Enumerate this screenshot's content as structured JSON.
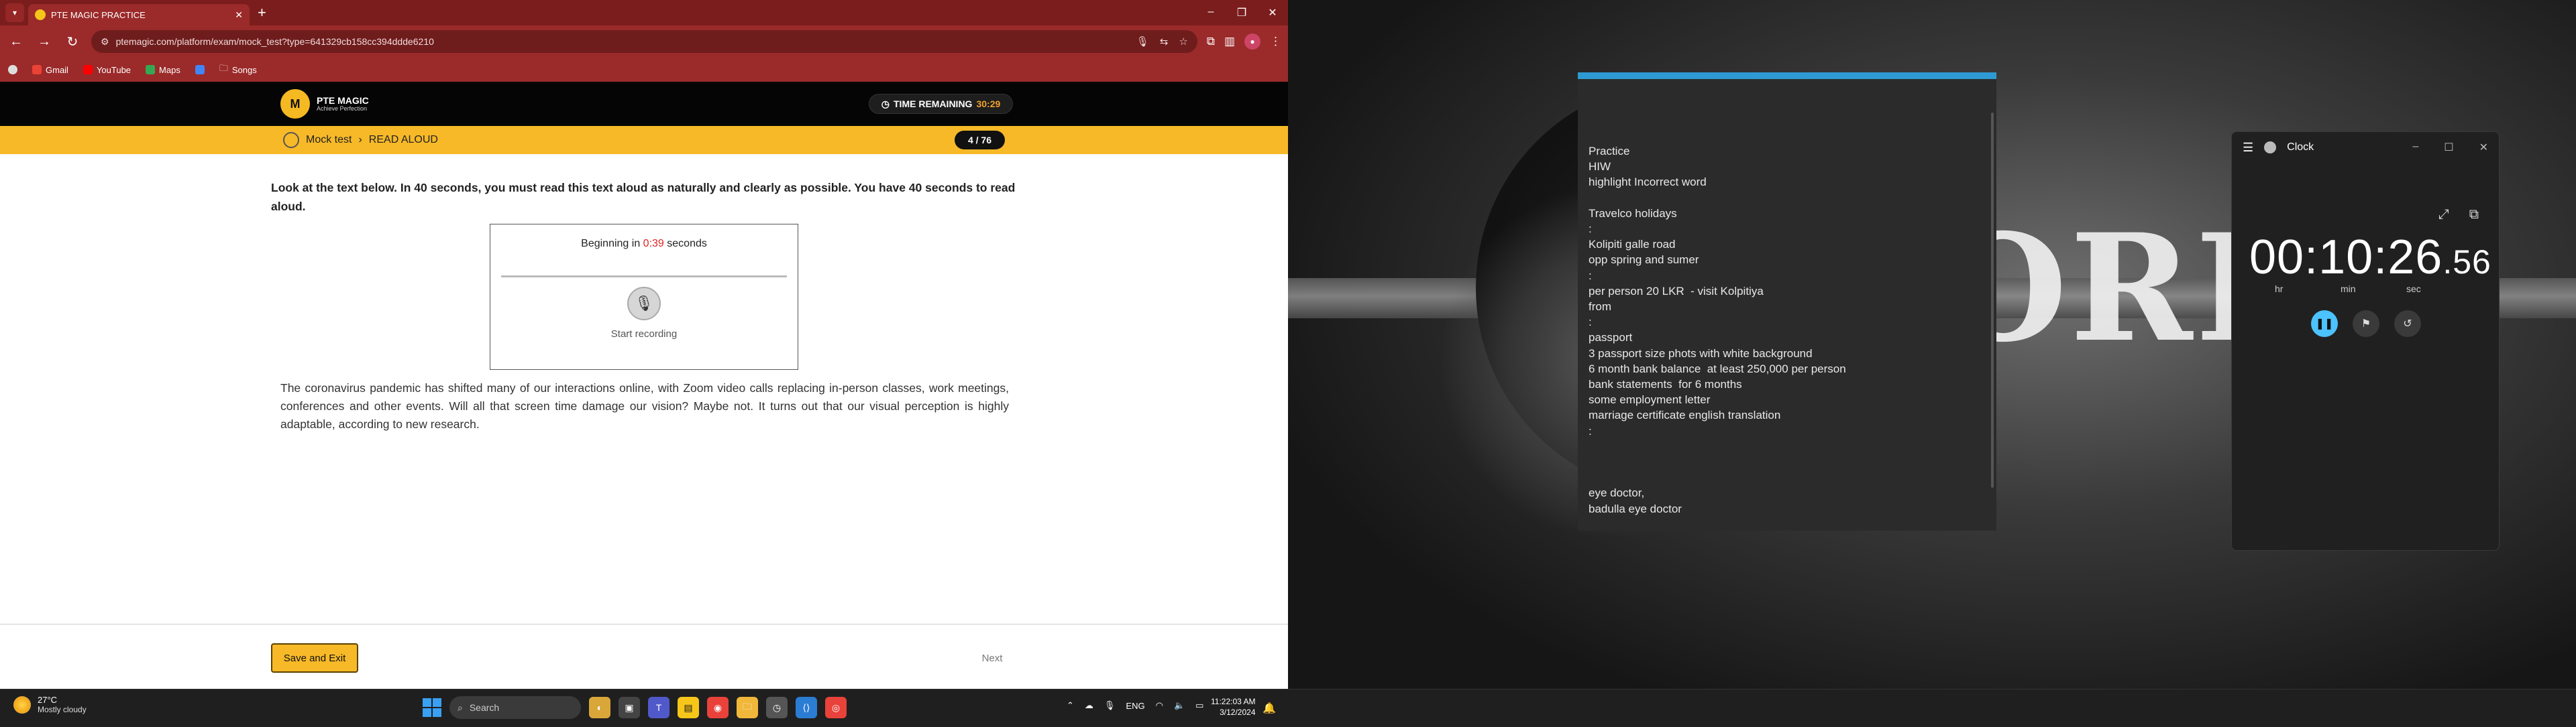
{
  "browser": {
    "tab_title": "PTE MAGIC PRACTICE",
    "url": "ptemagic.com/platform/exam/mock_test?type=641329cb158cc394ddde6210",
    "bookmarks": [
      "Gmail",
      "YouTube",
      "Maps",
      "Songs"
    ],
    "theme_color": "#9b2a2a"
  },
  "page": {
    "brand": "PTE MAGIC",
    "brand_sub": "Achieve Perfection",
    "timer_label": "TIME REMAINING",
    "timer_value": "30:29",
    "crumb_section": "Mock test",
    "crumb_task": "READ ALOUD",
    "progress": "4 / 76",
    "instructions": "Look at the text below. In 40 seconds, you must read this text aloud as naturally and clearly as possible. You have 40 seconds to read aloud.",
    "recorder": {
      "beginning_prefix": "Beginning in",
      "countdown": "0:39",
      "beginning_suffix": "seconds",
      "start_label": "Start recording"
    },
    "passage": "The coronavirus pandemic has shifted many of our interactions online, with Zoom video calls replacing in-person classes, work meetings, conferences and other events. Will all that screen time damage our vision? Maybe not. It turns out that our visual perception is highly adaptable, according to new research.",
    "save_label": "Save and Exit",
    "next_label": "Next",
    "accent": "#f7b928"
  },
  "notes": {
    "lines": [
      "Practice",
      "HIW",
      "highlight Incorrect word",
      "",
      "Travelco holidays",
      ":",
      "Kolipiti galle road",
      "opp spring and sumer",
      ":",
      "per person 20 LKR  - visit Kolpitiya",
      "from",
      ":",
      "passport",
      "3 passport size phots with white background",
      "6 month bank balance  at least 250,000 per person",
      "bank statements  for 6 months",
      "some employment letter",
      "marriage certificate english translation",
      ":",
      "",
      "",
      "",
      "eye doctor,",
      "badulla eye doctor"
    ]
  },
  "clock": {
    "title": "Clock",
    "hours": "00",
    "minutes": "10",
    "seconds": "26",
    "centis": ".56",
    "label_hr": "hr",
    "label_min": "min",
    "label_sec": "sec"
  },
  "wallpaper": {
    "text": "ORI"
  },
  "taskbar": {
    "temp": "27°C",
    "weather": "Mostly cloudy",
    "search_placeholder": "Search",
    "lang": "ENG",
    "time": "11:22:03 AM",
    "date": "3/12/2024"
  }
}
